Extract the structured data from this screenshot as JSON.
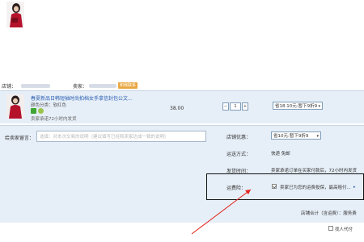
{
  "header": {
    "store_label": "店铺：",
    "seller_label": "卖家：",
    "contact_label": "和我联系"
  },
  "item": {
    "title": "春夏新品日韩短袖时尚拍档女手拿信封包公文...",
    "color_label": "颜色分类：软红色",
    "promise": "卖家承诺72小时内发货",
    "price": "38.00",
    "quantity": "1",
    "minus": "−",
    "plus": "+",
    "discount_option": "省18.10元:暂下9折9"
  },
  "message": {
    "label": "给卖家留言：",
    "placeholder": "选填：对本次交易的说明（建议填写已经和卖家达成一致的说明）"
  },
  "shop_promo": {
    "label": "店铺优惠：",
    "option": "省10元:暂下9折9"
  },
  "shipping": {
    "label": "运送方式：",
    "value": "快递 免邮"
  },
  "delivery": {
    "label": "发货时间：",
    "value": "卖家承诺订单在买家付款后，72小时内发货"
  },
  "insurance": {
    "label": "运费险：",
    "text": "卖家已为您的运费投保，最高赔付...",
    "arrow": "▸"
  },
  "total": {
    "label": "店铺合计（含运费）：服务费"
  },
  "agent": {
    "label": "找人代付"
  }
}
